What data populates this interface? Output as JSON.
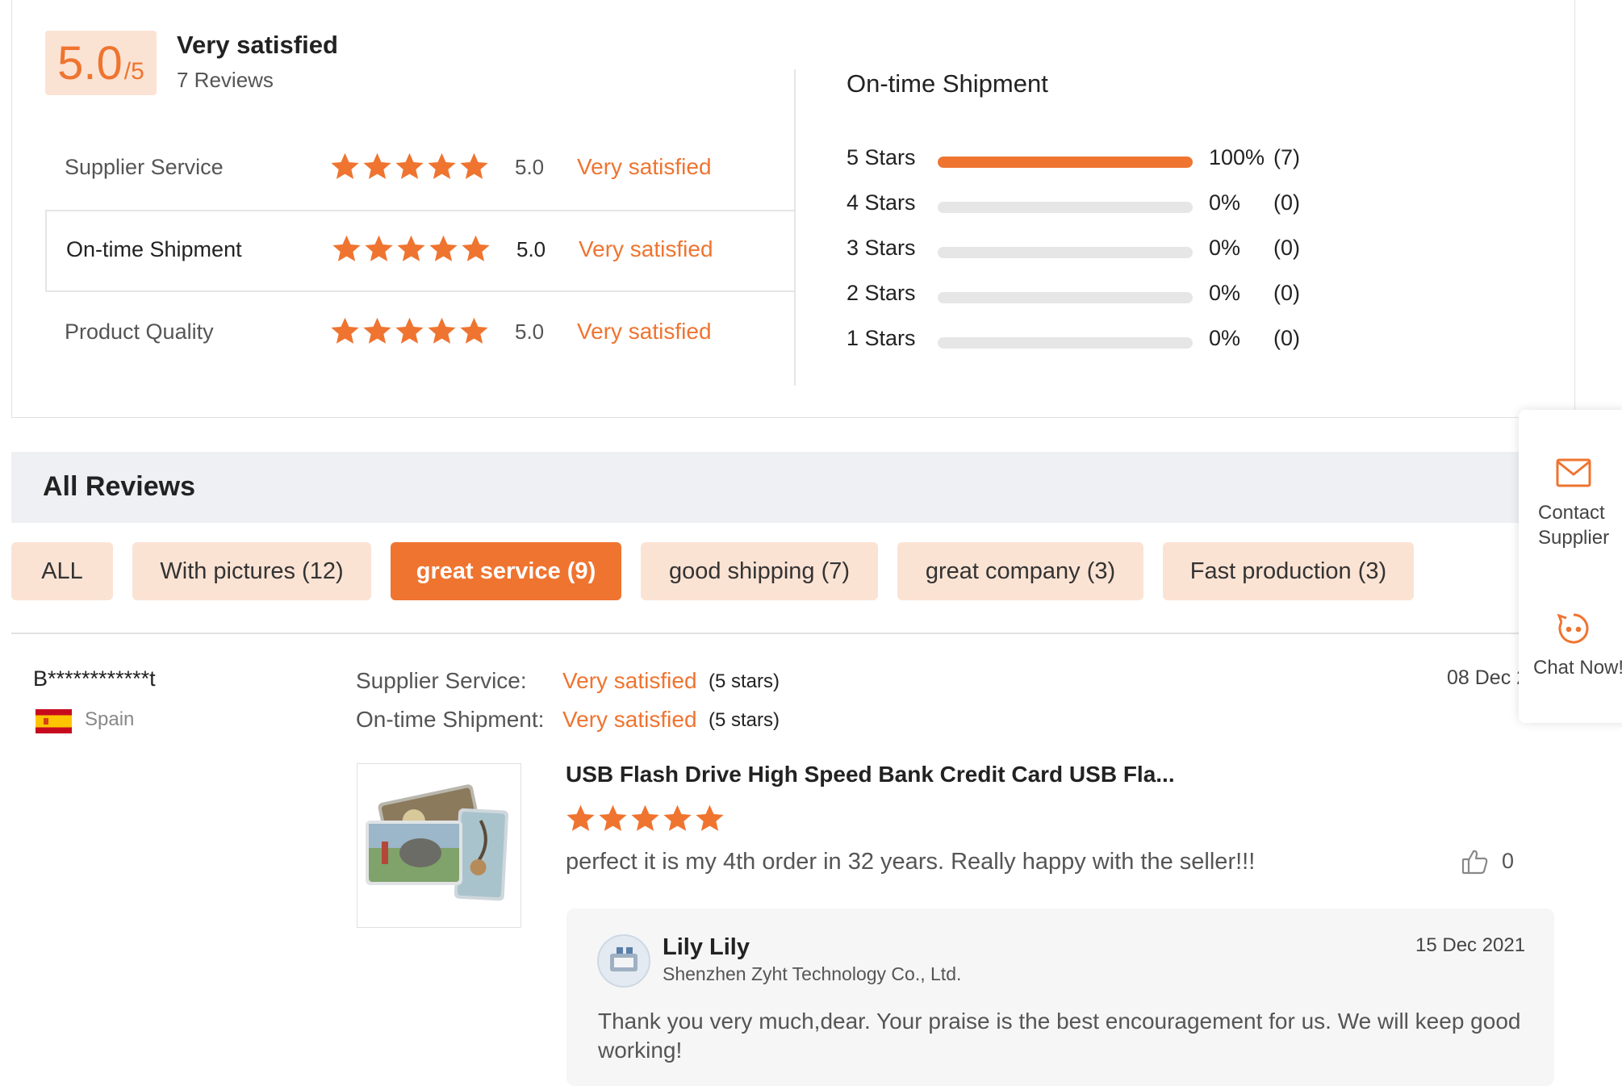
{
  "summary": {
    "score": "5.0",
    "score_max": "/5",
    "overall_label": "Very satisfied",
    "review_count": "7 Reviews",
    "metrics": [
      {
        "name": "Supplier Service",
        "score": "5.0",
        "label": "Very satisfied",
        "stars": 5
      },
      {
        "name": "On-time Shipment",
        "score": "5.0",
        "label": "Very satisfied",
        "stars": 5
      },
      {
        "name": "Product Quality",
        "score": "5.0",
        "label": "Very satisfied",
        "stars": 5
      }
    ],
    "distribution_title": "On-time Shipment",
    "distribution": [
      {
        "label": "5  Stars",
        "percent": "100%",
        "count": "(7)",
        "fraction": 1.0
      },
      {
        "label": "4  Stars",
        "percent": "0%",
        "count": "(0)",
        "fraction": 0
      },
      {
        "label": "3  Stars",
        "percent": "0%",
        "count": "(0)",
        "fraction": 0
      },
      {
        "label": "2  Stars",
        "percent": "0%",
        "count": "(0)",
        "fraction": 0
      },
      {
        "label": "1  Stars",
        "percent": "0%",
        "count": "(0)",
        "fraction": 0
      }
    ]
  },
  "all_reviews": {
    "title": "All Reviews",
    "tags": [
      {
        "label": "ALL",
        "selected": false
      },
      {
        "label": "With pictures (12)",
        "selected": false
      },
      {
        "label": "great service (9)",
        "selected": true
      },
      {
        "label": "good shipping (7)",
        "selected": false
      },
      {
        "label": "great company (3)",
        "selected": false
      },
      {
        "label": "Fast production (3)",
        "selected": false
      }
    ]
  },
  "review": {
    "reviewer": "B************t",
    "country": "Spain",
    "date": "08 Dec 2",
    "lines": [
      {
        "label": "Supplier Service:",
        "value": "Very satisfied",
        "stars": "(5 stars)"
      },
      {
        "label": "On-time Shipment:",
        "value": "Very satisfied",
        "stars": "(5 stars)"
      }
    ],
    "product_title": "USB Flash Drive High Speed Bank Credit Card USB Fla...",
    "rating": 5,
    "text": "perfect it is my 4th order in 32 years. Really happy with the seller!!!",
    "likes": "0",
    "reply": {
      "name": "Lily Lily",
      "company": "Shenzhen Zyht Technology Co., Ltd.",
      "date": "15 Dec 2021",
      "text": "Thank you very much,dear.  Your praise is the best encouragement for us. We will keep good working!"
    }
  },
  "side_panel": {
    "contact_label": "Contact Supplier",
    "chat_label": "Chat Now!"
  },
  "colors": {
    "accent": "#ef7430",
    "tag_bg": "#fbe3d4",
    "bar_track": "#e6e6e6"
  },
  "icons": [
    "star-icon",
    "spain-flag-icon",
    "thumbs-up-icon",
    "mail-icon",
    "chat-face-icon"
  ]
}
